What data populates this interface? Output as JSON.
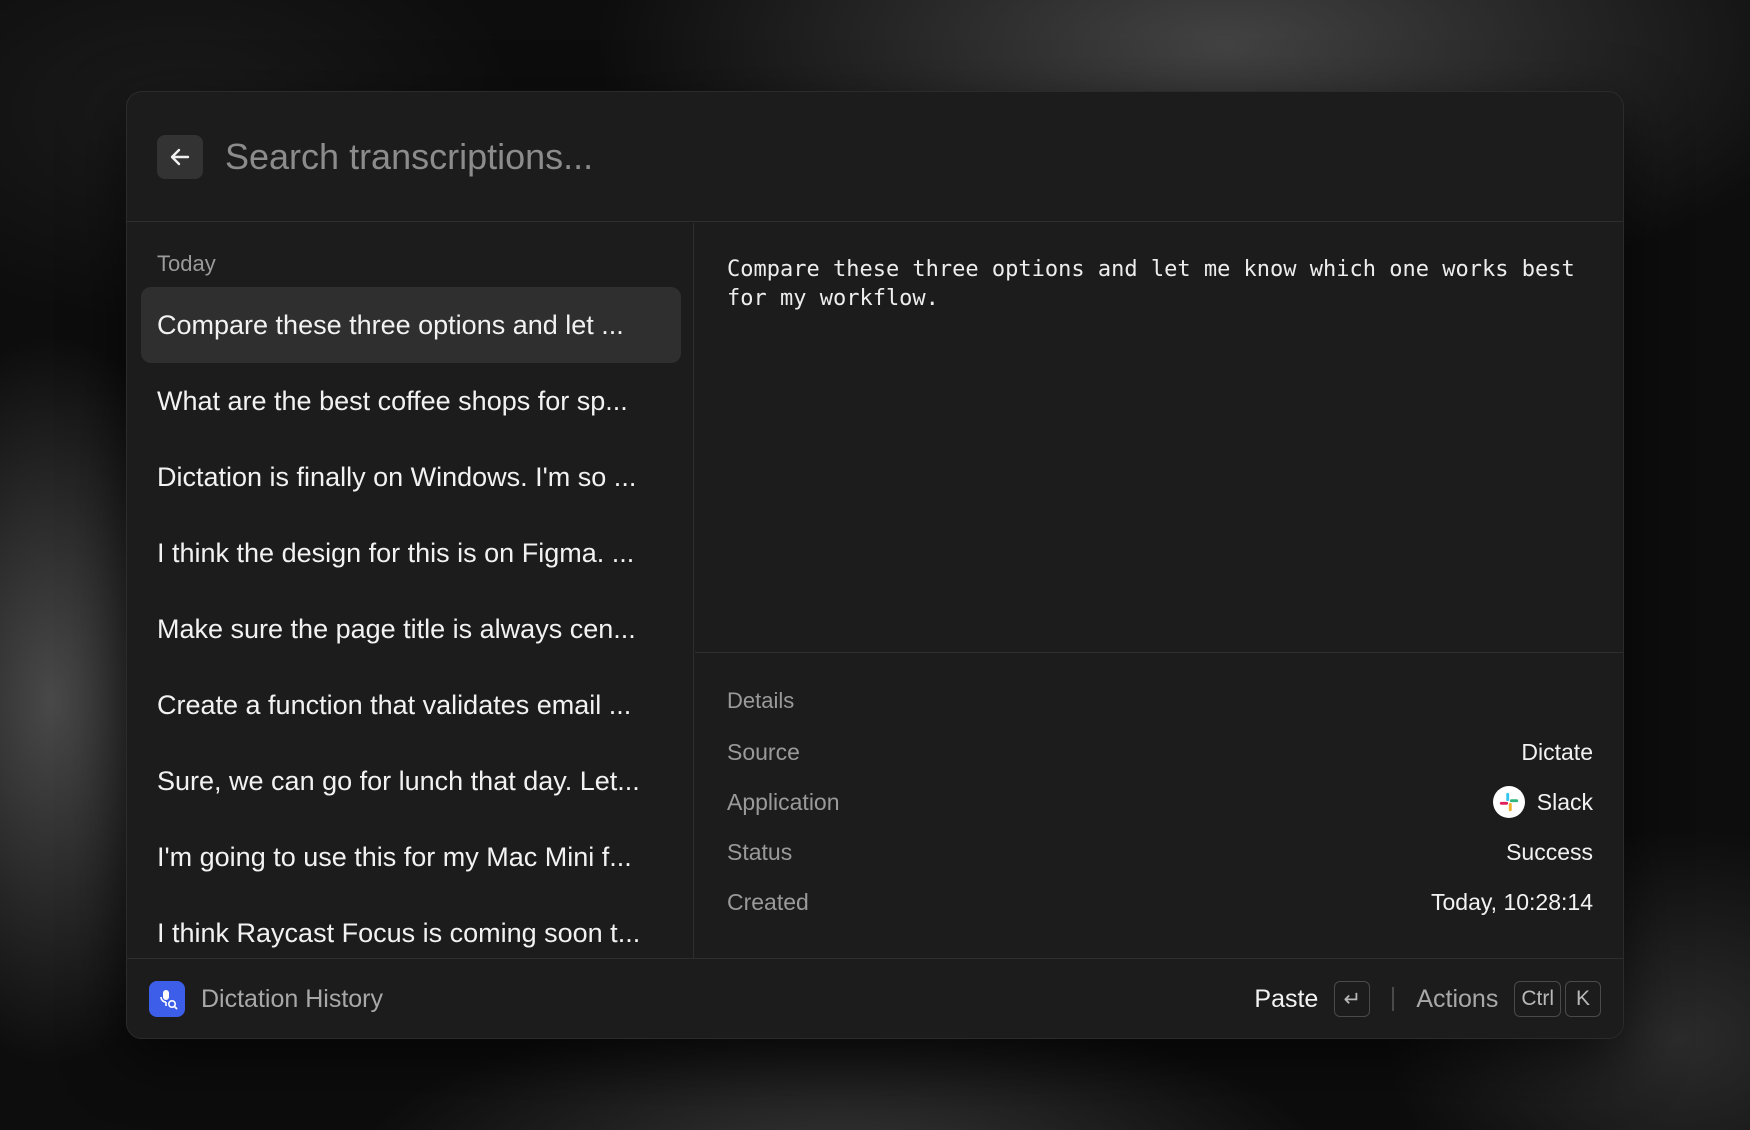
{
  "search": {
    "placeholder": "Search transcriptions..."
  },
  "history": {
    "section_label": "Today",
    "items": [
      "Compare these three options and let ...",
      "What are the best coffee shops for sp...",
      "Dictation is finally on Windows. I'm so ...",
      "I think the design for this is on Figma. ...",
      "Make sure the page title is always cen...",
      "Create a function that validates email ...",
      "Sure, we can go for lunch that day. Let...",
      "I'm going to use this for my Mac Mini f...",
      "I think Raycast Focus is coming soon t..."
    ]
  },
  "preview": {
    "text": "Compare these three options and let me know which one works best for my workflow."
  },
  "details": {
    "title": "Details",
    "source_label": "Source",
    "source_value": "Dictate",
    "application_label": "Application",
    "application_value": "Slack",
    "application_icon": "slack-icon",
    "status_label": "Status",
    "status_value": "Success",
    "created_label": "Created",
    "created_value": "Today, 10:28:14"
  },
  "footer": {
    "title": "Dictation History",
    "app_icon": "microphone-search-icon",
    "paste_label": "Paste",
    "paste_key": "↵",
    "actions_label": "Actions",
    "actions_key_1": "Ctrl",
    "actions_key_2": "K"
  },
  "colors": {
    "app_icon_bg": "#3d5ee8",
    "window_bg": "#1c1c1c",
    "selected_bg": "#2f2f2f"
  }
}
